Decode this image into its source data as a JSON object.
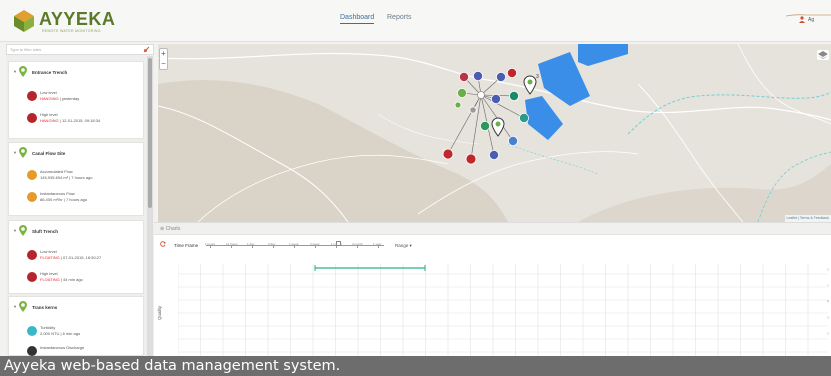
{
  "header": {
    "logo_text": "AYYEKA",
    "logo_subtitle": "REMOTE WATER MONITORING",
    "tabs": [
      {
        "label": "Dashboard",
        "active": true
      },
      {
        "label": "Reports",
        "active": false
      }
    ],
    "user_label": "Ag"
  },
  "sidebar": {
    "filter_placeholder": "Type to filter sites",
    "sites": [
      {
        "name": "Entrance Trench",
        "sensors": [
          {
            "name": "Low level",
            "status": "HANGING",
            "time": "yesterday",
            "color": "#b5252b"
          },
          {
            "name": "High level",
            "status": "HANGING",
            "time": "12-01-2015, 09:18:34",
            "color": "#b5252b"
          }
        ]
      },
      {
        "name": "Canal Flow Site",
        "sensors": [
          {
            "name": "Accumulated Flow",
            "status": "145,935.694 m³",
            "time": "7 hours ago",
            "color": "#e49b2a"
          },
          {
            "name": "Instantaneous Flow",
            "status": "86.400 m³/hr",
            "time": "7 hours ago",
            "color": "#e49b2a"
          }
        ]
      },
      {
        "name": "Sluft Trench",
        "sensors": [
          {
            "name": "Low level",
            "status": "FLOATING",
            "time": "07-01-2015, 16:50:27",
            "color": "#b5252b"
          },
          {
            "name": "High level",
            "status": "FLOATING",
            "time": "44 min ago",
            "color": "#b5252b"
          }
        ]
      },
      {
        "name": "Trans kerns",
        "sensors": [
          {
            "name": "Turbidity",
            "status": "2.000 NTU",
            "time": "6 min ago",
            "color": "#3ab7c9"
          },
          {
            "name": "Instantaneous Discharge",
            "status": "",
            "time": "",
            "color": "#333333"
          }
        ]
      }
    ]
  },
  "map": {
    "zoom_in": "+",
    "zoom_out": "−",
    "attribution": "Leaflet | Terms & Feedback",
    "hub_count": "3",
    "markers": [
      {
        "color": "#4a5db0"
      },
      {
        "color": "#4a5db0"
      },
      {
        "color": "#b83548"
      },
      {
        "color": "#6ab04a"
      },
      {
        "color": "#9a9a9a"
      },
      {
        "color": "#4a5db0"
      },
      {
        "color": "#1a8a6a"
      },
      {
        "color": "#2a9a8a"
      },
      {
        "color": "#4a80d0"
      },
      {
        "color": "#4a5db0"
      },
      {
        "color": "#c0262c"
      },
      {
        "color": "#c0262c"
      },
      {
        "color": "#c0262c"
      },
      {
        "color": "#2a9a5a"
      },
      {
        "color": "#6ab04a"
      }
    ]
  },
  "charts": {
    "title": "Charts",
    "time_frame_label": "Time Frame",
    "timeframe_ticks": [
      "1 hours",
      "12 hours",
      "1 day",
      "3 day",
      "1 week",
      "2 week",
      "1 month",
      "3 month",
      "1 year"
    ],
    "range_label": "Range",
    "y_axis_label": "Quality"
  },
  "caption": "Ayyeka web-based data management system.",
  "colors": {
    "brand": "#5a7a2a",
    "water": "#3a8ee8",
    "map_background": "#e6e2dc",
    "road": "#ffffff",
    "alert_text": "#e8282e",
    "river_teal": "#6fd0d4",
    "range_line": "#2ab08a"
  }
}
